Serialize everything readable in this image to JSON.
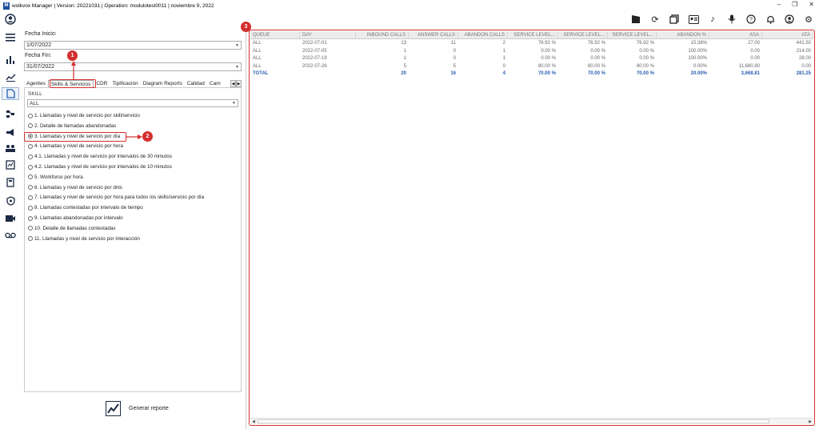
{
  "window": {
    "logo_letter": "M",
    "title": "wolkvox Manager  | Version: 20221031  |  Operation: modulotest0011  |  noviembre 9, 2022",
    "min": "–",
    "restore": "❐",
    "close": "✕"
  },
  "toolbar_icons": [
    "clapperboard-icon",
    "refresh-icon",
    "gallery-icon",
    "id-card-icon",
    "music-note-icon",
    "microphone-icon",
    "help-icon",
    "bell-icon",
    "user-icon",
    "settings-icon"
  ],
  "nav_icons": [
    "avatar-icon",
    "menu-icon",
    "bar-chart-icon",
    "trend-icon",
    "reports-icon",
    "org-chart-icon",
    "megaphone-icon",
    "users-group-icon",
    "dashboard-icon",
    "calculator-icon",
    "shield-icon",
    "video-add-icon",
    "voicemail-icon"
  ],
  "filters": {
    "start_label": "Fecha Inicio:",
    "start_value": "1/07/2022",
    "end_label": "Fecha Fin:",
    "end_value": "31/07/2022"
  },
  "tabs": [
    "Agentes",
    "Skills & Servicios",
    "CDR",
    "Tipificación",
    "Diagram Reports",
    "Calidad",
    "Cam"
  ],
  "active_tab": "Skills & Servicios",
  "skill": {
    "label": "SKILL",
    "value": "ALL"
  },
  "reports": [
    "1. Llamadas y nivel de servicio por skill/servicio",
    "2. Detalle de llamadas abandonadas",
    "3. Llamadas y nivel de servicio por día",
    "4. Llamadas y nivel de servicio por hora",
    "4.1. Llamadas y nivel de servicio por intervalos de 30 minutos",
    "4.2. Llamadas y nivel de servicio por intervalos de 10 minutos",
    "5. Workforce por hora",
    "6. Llamadas y nivel de servicio por dnis",
    "7. Llamadas y nivel de servicio por hora para todos los skills/servicio por día",
    "8. Llamadas contestadas por intervalo de tiempo",
    "9. Llamadas abandonadas por intervalo",
    "10. Detalle de llamadas contestadas",
    "11. Llamadas y nivel de servicio por interacción"
  ],
  "selected_report": "3. Llamadas y nivel de servicio por día",
  "generate_label": "Generar reporte",
  "badges": [
    "1",
    "2",
    "3"
  ],
  "grid": {
    "columns": [
      "QUEUE",
      "DAY",
      "INBOUND CALLS",
      "ANSWER CALLS",
      "ABANDON CALLS",
      "SERVICE LEVEL...",
      "SERVICE LEVEL...",
      "SERVICE LEVEL...",
      "ABANDON %",
      "ASA",
      "ATA"
    ],
    "rows": [
      [
        "ALL",
        "2022-07-01",
        "13",
        "11",
        "2",
        "76.92 %",
        "76.92 %",
        "76.92 %",
        "15.38%",
        "27.00",
        "441.50"
      ],
      [
        "ALL",
        "2022-07-05",
        "1",
        "0",
        "1",
        "0.00 %",
        "0.00 %",
        "0.00 %",
        "100.00%",
        "0.00",
        "214.00"
      ],
      [
        "ALL",
        "2022-07-19",
        "1",
        "0",
        "1",
        "0.00 %",
        "0.00 %",
        "0.00 %",
        "100.00%",
        "0.00",
        "28.00"
      ],
      [
        "ALL",
        "2022-07-26",
        "5",
        "5",
        "0",
        "80.00 %",
        "80.00 %",
        "80.00 %",
        "0.00%",
        "11,680.80",
        "0.00"
      ]
    ],
    "total": [
      "TOTAL",
      "",
      "20",
      "16",
      "4",
      "70.00 %",
      "70.00 %",
      "70.00 %",
      "20.00%",
      "3,668.81",
      "281.25"
    ]
  },
  "colors": {
    "annotation": "#d32f2f",
    "total_text": "#2b5fb3"
  }
}
